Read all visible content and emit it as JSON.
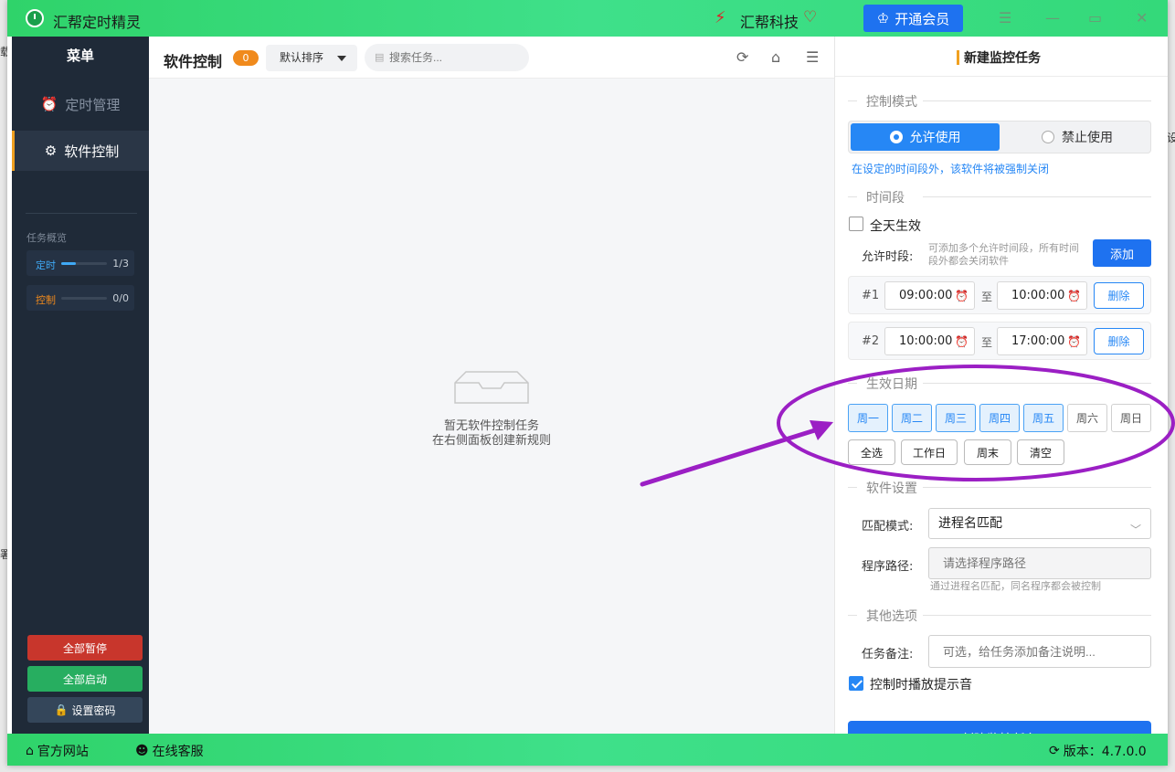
{
  "window": {
    "title": "汇帮定时精灵",
    "brand": "汇帮科技",
    "vip_button": "开通会员"
  },
  "sidebar": {
    "menu_title": "菜单",
    "items": [
      {
        "label": "定时管理",
        "icon": "alarm-clock-icon",
        "active": false
      },
      {
        "label": "软件控制",
        "icon": "gear-icon",
        "active": true
      }
    ],
    "overview_title": "任务概览",
    "overview": [
      {
        "label": "定时",
        "count": "1/3",
        "progress": 0.33,
        "color": "#3fa9f5"
      },
      {
        "label": "控制",
        "count": "0/0",
        "progress": 0,
        "color": "#f08a1c"
      }
    ],
    "buttons": {
      "pause_all": "全部暂停",
      "start_all": "全部启动",
      "set_password": "设置密码"
    }
  },
  "main": {
    "title": "软件控制",
    "badge": "0",
    "sort_label": "默认排序",
    "search_placeholder": "搜索任务...",
    "empty_line1": "暂无软件控制任务",
    "empty_line2": "在右侧面板创建新规则"
  },
  "panel": {
    "title": "新建监控任务",
    "section_mode": "控制模式",
    "mode_allow": "允许使用",
    "mode_deny": "禁止使用",
    "mode_hint": "在设定的时间段外，该软件将被强制关闭",
    "section_time": "时间段",
    "all_day": "全天生效",
    "allow_period_label": "允许时段:",
    "allow_period_hint": "可添加多个允许时间段，所有时间段外都会关闭软件",
    "add_button": "添加",
    "periods": [
      {
        "index": "#1",
        "start": "09:00:00",
        "end": "10:00:00"
      },
      {
        "index": "#2",
        "start": "10:00:00",
        "end": "17:00:00"
      }
    ],
    "to_label": "至",
    "delete_button": "删除",
    "section_days": "生效日期",
    "days": [
      {
        "label": "周一",
        "on": true
      },
      {
        "label": "周二",
        "on": true
      },
      {
        "label": "周三",
        "on": true
      },
      {
        "label": "周四",
        "on": true
      },
      {
        "label": "周五",
        "on": true
      },
      {
        "label": "周六",
        "on": false
      },
      {
        "label": "周日",
        "on": false
      }
    ],
    "quick": [
      "全选",
      "工作日",
      "周末",
      "清空"
    ],
    "section_software": "软件设置",
    "match_label": "匹配模式:",
    "match_value": "进程名匹配",
    "path_label": "程序路径:",
    "path_placeholder": "请选择程序路径",
    "path_hint": "通过进程名匹配，同名程序都会被控制",
    "section_other": "其他选项",
    "note_label": "任务备注:",
    "note_placeholder": "可选，给任务添加备注说明...",
    "play_sound": "控制时播放提示音",
    "submit": "创建监控任务"
  },
  "statusbar": {
    "website": "官方网站",
    "support": "在线客服",
    "version": "版本：4.7.0.0"
  },
  "colors": {
    "accent": "#1e72f0",
    "green": "#2fd36a",
    "sidebar": "#1f2a38",
    "annotation": "#9b1fc4"
  }
}
